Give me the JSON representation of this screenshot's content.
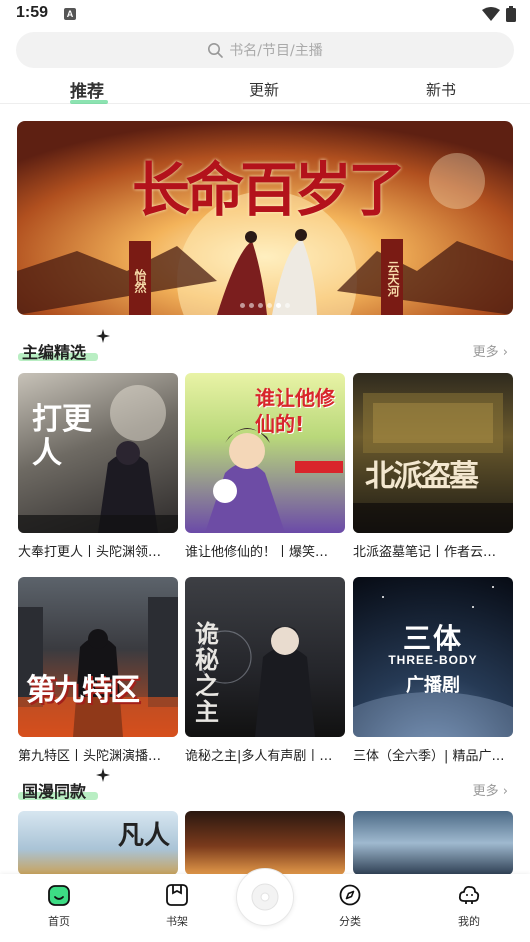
{
  "status": {
    "time": "1:59",
    "notif_icon": "A"
  },
  "search": {
    "placeholder": "书名/节目/主播"
  },
  "tabs": [
    {
      "label": "推荐",
      "active": true
    },
    {
      "label": "更新",
      "active": false
    },
    {
      "label": "新书",
      "active": false
    }
  ],
  "banner": {
    "headline": "长命百岁了",
    "side_left": "怡然",
    "side_right": "云天河",
    "dots": 6,
    "active_dot": 5
  },
  "sections": [
    {
      "title": "主编精选",
      "more": "更多",
      "items": [
        {
          "title": "大奉打更人丨头陀渊领…",
          "cover_text": "打更人"
        },
        {
          "title": "谁让他修仙的！丨爆笑…",
          "cover_text": "谁让他修仙的!"
        },
        {
          "title": "北派盗墓笔记丨作者云…",
          "cover_text": "北派盗墓"
        },
        {
          "title": "第九特区丨头陀渊演播…",
          "cover_text": "第九特区"
        },
        {
          "title": "诡秘之主|多人有声剧丨…",
          "cover_text": "诡秘之主"
        },
        {
          "title": "三体（全六季）| 精品广…",
          "cover_text": "三体",
          "cover_sub": "THREE-BODY",
          "cover_sub2": "广播剧"
        }
      ]
    },
    {
      "title": "国漫同款",
      "more": "更多",
      "items": [
        {
          "cover_text": "凡人"
        },
        {
          "cover_text": ""
        },
        {
          "cover_text": ""
        }
      ]
    }
  ],
  "bottom_nav": [
    {
      "label": "首页",
      "icon": "home-icon",
      "active": true
    },
    {
      "label": "书架",
      "icon": "bookshelf-icon",
      "active": false
    },
    {
      "label": "分类",
      "icon": "compass-icon",
      "active": false
    },
    {
      "label": "我的",
      "icon": "profile-icon",
      "active": false
    }
  ],
  "colors": {
    "accent": "#2ecc71",
    "more": "#999999",
    "search_bg": "#f2f2f2"
  }
}
